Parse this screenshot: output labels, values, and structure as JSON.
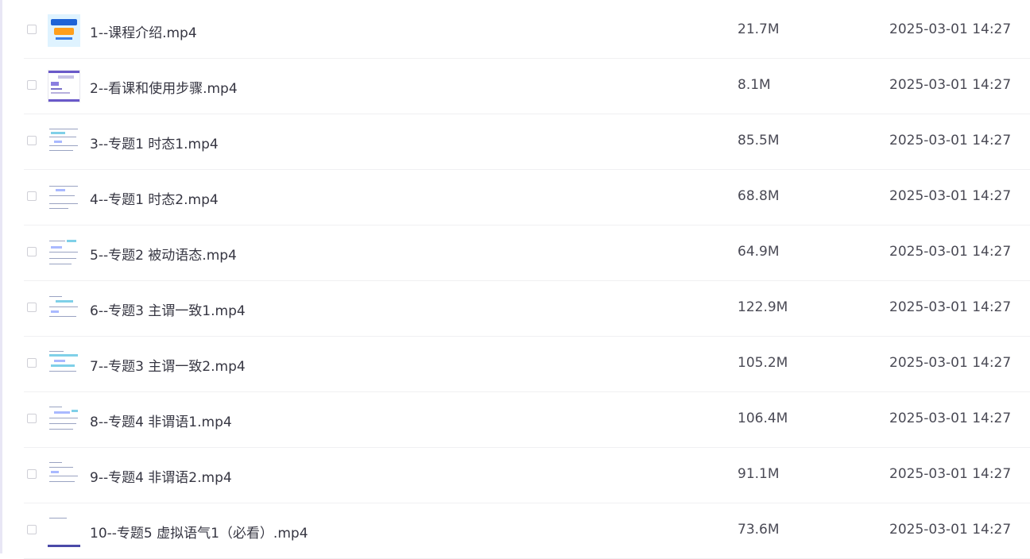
{
  "files": [
    {
      "name": "1--课程介绍.mp4",
      "size": "21.7M",
      "date": "2025-03-01 14:27",
      "thumb": "cover-icon"
    },
    {
      "name": "2--看课和使用步骤.mp4",
      "size": "8.1M",
      "date": "2025-03-01 14:27",
      "thumb": "slide-icon"
    },
    {
      "name": "3--专题1 时态1.mp4",
      "size": "85.5M",
      "date": "2025-03-01 14:27",
      "thumb": "document-icon"
    },
    {
      "name": "4--专题1 时态2.mp4",
      "size": "68.8M",
      "date": "2025-03-01 14:27",
      "thumb": "document-icon"
    },
    {
      "name": "5--专题2 被动语态.mp4",
      "size": "64.9M",
      "date": "2025-03-01 14:27",
      "thumb": "document-icon"
    },
    {
      "name": "6--专题3 主谓一致1.mp4",
      "size": "122.9M",
      "date": "2025-03-01 14:27",
      "thumb": "document-icon"
    },
    {
      "name": "7--专题3 主谓一致2.mp4",
      "size": "105.2M",
      "date": "2025-03-01 14:27",
      "thumb": "document-icon"
    },
    {
      "name": "8--专题4 非谓语1.mp4",
      "size": "106.4M",
      "date": "2025-03-01 14:27",
      "thumb": "document-icon"
    },
    {
      "name": "9--专题4 非谓语2.mp4",
      "size": "91.1M",
      "date": "2025-03-01 14:27",
      "thumb": "document-icon"
    },
    {
      "name": "10--专题5 虚拟语气1（必看）.mp4",
      "size": "73.6M",
      "date": "2025-03-01 14:27",
      "thumb": "document-icon"
    }
  ],
  "colors": {
    "text": "#363642",
    "meta_text": "#4a4a55",
    "divider": "#f0f0f2",
    "accent": "#6a59c9"
  }
}
